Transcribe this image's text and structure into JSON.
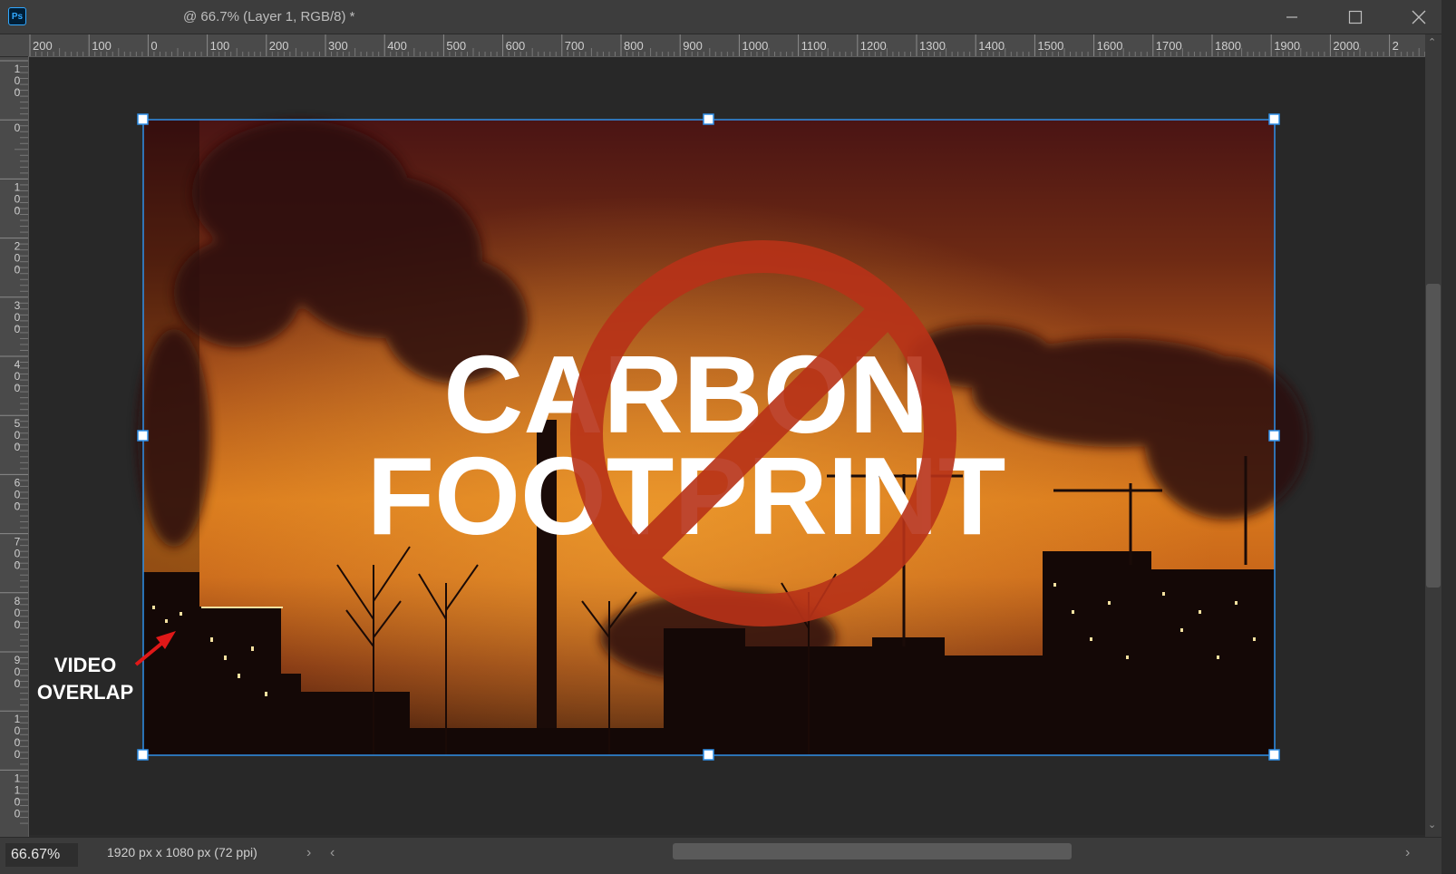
{
  "window": {
    "app_logo": "Ps",
    "title": "@ 66.7% (Layer 1, RGB/8) *",
    "controls": [
      "minimize-icon",
      "maximize-icon",
      "close-icon"
    ]
  },
  "rulers": {
    "horizontal": [
      "200",
      "100",
      "0",
      "100",
      "200",
      "300",
      "400",
      "500",
      "600",
      "700",
      "800",
      "900",
      "1000",
      "1100",
      "1200",
      "1300",
      "1400",
      "1500",
      "1600",
      "1700",
      "1800",
      "1900",
      "2000",
      "2"
    ],
    "vertical": [
      "100",
      "0",
      "100",
      "200",
      "300",
      "400",
      "500",
      "600",
      "700",
      "800",
      "900",
      "1000",
      "1100"
    ]
  },
  "artwork": {
    "line1": "CARBON",
    "line2": "FOOTPRINT",
    "symbol": "no-sign-icon"
  },
  "annotation": {
    "line1": "VIDEO",
    "line2": "OVERLAP",
    "arrow": "arrow-icon"
  },
  "status_bar": {
    "zoom": "66.67%",
    "doc_info": "1920 px x 1080 px (72 ppi)"
  },
  "colors": {
    "selection": "#2f8fe8",
    "no_sign": "#b83218",
    "sky_top": "#4a1414",
    "sky_mid": "#d8781c"
  }
}
